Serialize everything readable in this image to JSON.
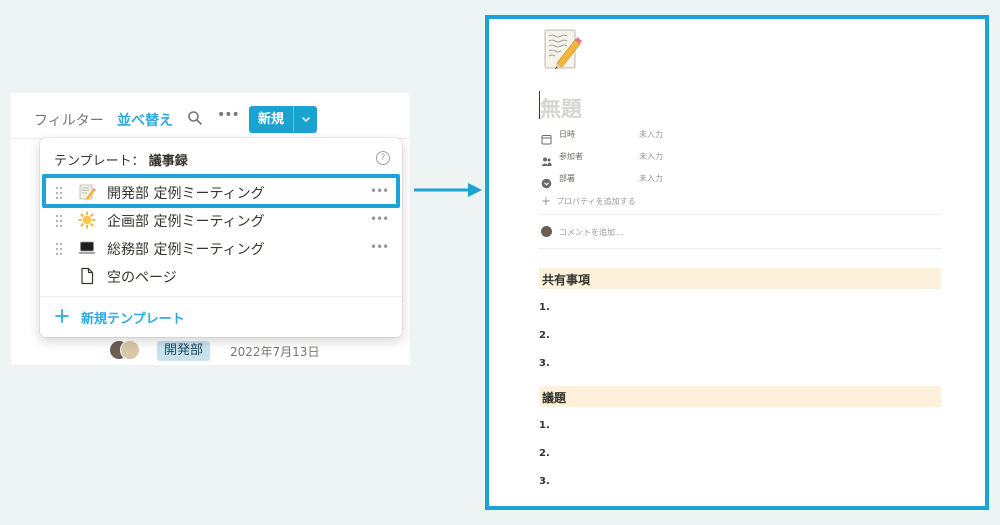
{
  "left": {
    "toolbar": {
      "filter": "フィルター",
      "sort": "並べ替え",
      "search_icon": "search-icon",
      "more_icon": "more-horizontal-icon",
      "new_label": "新規",
      "new_chevron_icon": "chevron-down-icon"
    },
    "dropdown": {
      "header_prefix": "テンプレート：",
      "header_name": "議事録",
      "help_icon": "help-circle-icon",
      "help_glyph": "?",
      "templates": [
        {
          "label": "開発部 定例ミーティング",
          "icon": "memo-pencil-icon",
          "more": "•••",
          "selected": true
        },
        {
          "label": "企画部 定例ミーティング",
          "icon": "sun-icon",
          "more": "•••",
          "selected": false
        },
        {
          "label": "総務部 定例ミーティング",
          "icon": "laptop-icon",
          "more": "•••",
          "selected": false
        },
        {
          "label": "空のページ",
          "icon": "document-icon",
          "more": "",
          "selected": false
        }
      ],
      "new_template": "新規テンプレート",
      "new_template_icon": "plus-icon"
    },
    "row": {
      "department": "開発部",
      "date": "2022年7月13日"
    }
  },
  "page": {
    "icon": "memo-pencil-icon",
    "title": "無題",
    "properties": [
      {
        "label": "日時",
        "value": "未入力",
        "icon": "calendar-icon"
      },
      {
        "label": "参加者",
        "value": "未入力",
        "icon": "people-icon"
      },
      {
        "label": "部署",
        "value": "未入力",
        "icon": "select-icon"
      }
    ],
    "add_property": "プロパティを追加する",
    "add_comment": "コメントを追加...",
    "sections": [
      {
        "title": "共有事項",
        "items": [
          "1.",
          "2.",
          "3."
        ]
      },
      {
        "title": "議題",
        "items": [
          "1.",
          "2.",
          "3."
        ]
      }
    ]
  },
  "colors": {
    "accent": "#1aa3d4",
    "link": "#2eaadc",
    "section_bg": "#fdf1dc",
    "tag_bg": "#c9e2ec"
  }
}
